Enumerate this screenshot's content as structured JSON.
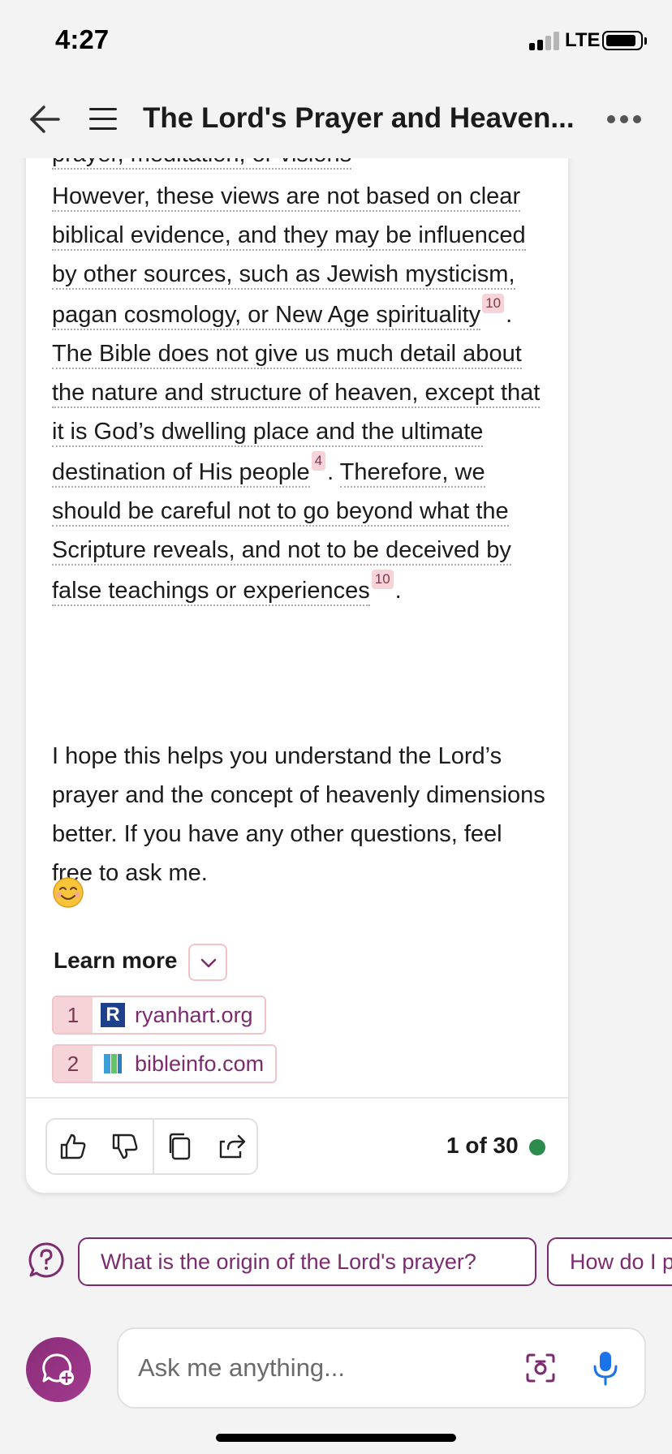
{
  "status_bar": {
    "time": "4:27",
    "network": "LTE"
  },
  "header": {
    "title": "The Lord's Prayer and Heaven..."
  },
  "message": {
    "cut_line": "prayer, meditation, or visions",
    "p1_s1": "However, these views are not based on clear biblical evidence, and they may be influenced by other sources, such as Jewish mysticism, pagan cosmology, or New Age spirituality",
    "p1_c1": "10",
    "p1_s2": "The Bible does not give us much detail about the nature and structure of heaven, except that it is God’s dwelling place and the ultimate destination of His people",
    "p1_c2": "4",
    "p1_s3": "Therefore, we should be careful not to go beyond what the Scripture reveals, and not to be deceived by false teachings or experiences",
    "p1_c3": "10",
    "p2": "I hope this helps you understand the Lord’s prayer and the concept of heavenly dimensions better. If you have any other questions, feel free to ask me."
  },
  "learn_more": {
    "label": "Learn more",
    "sources": [
      {
        "num": "1",
        "label": "ryanhart.org",
        "favicon": "R"
      },
      {
        "num": "2",
        "label": "bibleinfo.com"
      }
    ]
  },
  "actions": {
    "turn_count": "1 of 30",
    "status_color": "#2e8b4e"
  },
  "suggestions": [
    "What is the origin of the Lord's prayer?",
    "How do I p"
  ],
  "composer": {
    "placeholder": "Ask me anything..."
  },
  "colors": {
    "accent": "#7b2b6e",
    "citation_bg": "#f6d3d6"
  }
}
